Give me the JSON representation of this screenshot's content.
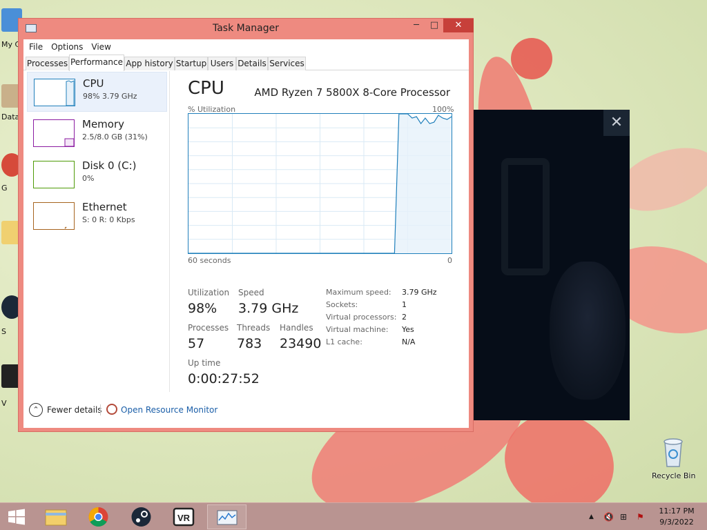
{
  "desktop": {
    "icons": [
      {
        "label": "My C"
      },
      {
        "label": "Data"
      },
      {
        "label": "G"
      },
      {
        "label": "S"
      },
      {
        "label": "V"
      }
    ],
    "recycle_bin_label": "Recycle Bin"
  },
  "overlay": {
    "close_glyph": "✕"
  },
  "window": {
    "title": "Task Manager",
    "minimize_glyph": "─",
    "maximize_glyph": "□",
    "close_glyph": "✕"
  },
  "menu": {
    "file": "File",
    "options": "Options",
    "view": "View"
  },
  "tabs": [
    {
      "label": "Processes",
      "active": false
    },
    {
      "label": "Performance",
      "active": true
    },
    {
      "label": "App history",
      "active": false
    },
    {
      "label": "Startup",
      "active": false
    },
    {
      "label": "Users",
      "active": false
    },
    {
      "label": "Details",
      "active": false
    },
    {
      "label": "Services",
      "active": false
    }
  ],
  "sidebar": {
    "items": [
      {
        "name": "CPU",
        "sub": "98%  3.79 GHz",
        "color": "#1f7fbb",
        "active": true
      },
      {
        "name": "Memory",
        "sub": "2.5/8.0 GB (31%)",
        "color": "#8b1ba1",
        "active": false
      },
      {
        "name": "Disk 0 (C:)",
        "sub": "0%",
        "color": "#4e9a06",
        "active": false
      },
      {
        "name": "Ethernet",
        "sub": "S: 0  R: 0 Kbps",
        "color": "#a6631e",
        "active": false
      }
    ]
  },
  "cpu": {
    "title": "CPU",
    "model": "AMD Ryzen 7 5800X 8-Core Processor",
    "util_label": "% Utilization",
    "util_max": "100%",
    "axis_left": "60 seconds",
    "axis_right": "0",
    "stats": {
      "utilization_label": "Utilization",
      "utilization_value": "98%",
      "speed_label": "Speed",
      "speed_value": "3.79 GHz",
      "processes_label": "Processes",
      "processes_value": "57",
      "threads_label": "Threads",
      "threads_value": "783",
      "handles_label": "Handles",
      "handles_value": "23490",
      "uptime_label": "Up time",
      "uptime_value": "0:00:27:52"
    },
    "details": [
      {
        "label": "Maximum speed:",
        "value": "3.79 GHz"
      },
      {
        "label": "Sockets:",
        "value": "1"
      },
      {
        "label": "Virtual processors:",
        "value": "2"
      },
      {
        "label": "Virtual machine:",
        "value": "Yes"
      },
      {
        "label": "L1 cache:",
        "value": "N/A"
      }
    ]
  },
  "chart_data": {
    "type": "area",
    "ylabel": "% Utilization",
    "xlabel": "60 seconds",
    "ylim": [
      0,
      100
    ],
    "x": [
      60,
      59,
      58,
      57,
      56,
      55,
      54,
      53,
      52,
      51,
      50,
      48,
      46,
      44,
      42,
      40,
      38,
      36,
      34,
      32,
      30,
      28,
      26,
      24,
      22,
      20,
      18,
      16,
      14,
      13,
      12,
      11,
      10,
      9,
      8,
      7,
      6,
      5,
      4,
      3,
      2,
      1,
      0
    ],
    "values": [
      0,
      0,
      0,
      0,
      0,
      0,
      0,
      0,
      0,
      0,
      0,
      0,
      0,
      0,
      0,
      0,
      0,
      0,
      0,
      0,
      0,
      0,
      0,
      0,
      0,
      0,
      0,
      0,
      0,
      0,
      100,
      100,
      100,
      97,
      98,
      93,
      97,
      93,
      94,
      99,
      97,
      96,
      98
    ]
  },
  "footer": {
    "fewer_details": "Fewer details",
    "fewer_glyph": "⌃",
    "open_resource_monitor": "Open Resource Monitor"
  },
  "taskbar": {
    "items": [
      "start-button",
      "file-explorer",
      "chrome",
      "steam",
      "vr",
      "task-manager"
    ],
    "clock_time": "11:17 PM",
    "clock_date": "9/3/2022",
    "tray_up": "▲",
    "tray_volume": "🔇",
    "tray_network": "⊞",
    "tray_flag": "⚑"
  }
}
